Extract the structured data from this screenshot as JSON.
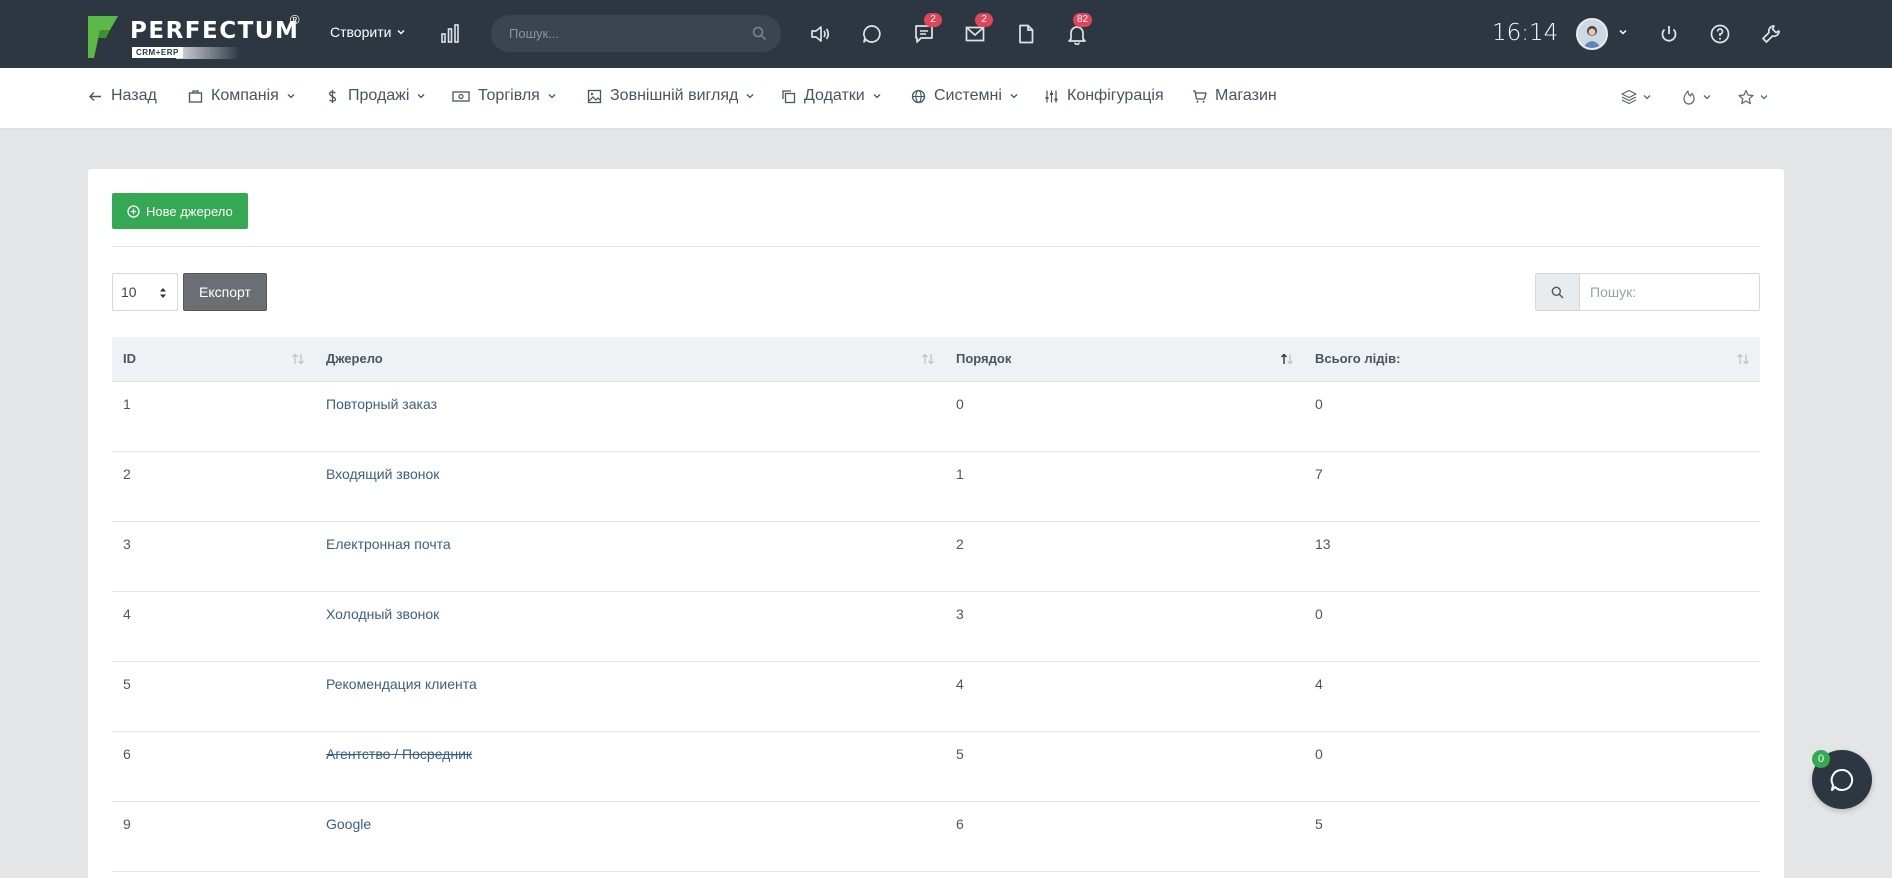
{
  "colors": {
    "topbar": "#2d3742",
    "accent_green": "#34a853",
    "badge_red": "#e0455c",
    "link": "#3a5f86"
  },
  "logo": {
    "word": "PERFECTUM",
    "reg": "®",
    "sub": "CRM+ERP"
  },
  "topbar": {
    "create_label": "Створити",
    "search_placeholder": "Пошук...",
    "badges": {
      "messages": "2",
      "mail": "2",
      "notifications": "82"
    },
    "clock": "16:14"
  },
  "nav": {
    "items": [
      {
        "label": "Назад",
        "icon": "arrow-left-icon"
      },
      {
        "label": "Компанія",
        "icon": "briefcase-icon"
      },
      {
        "label": "Продажі",
        "icon": "dollar-icon"
      },
      {
        "label": "Торгівля",
        "icon": "money-icon"
      },
      {
        "label": "Зовнішній вигляд",
        "icon": "image-icon"
      },
      {
        "label": "Додатки",
        "icon": "copy-icon"
      },
      {
        "label": "Системні",
        "icon": "globe-icon"
      },
      {
        "label": "Конфігурація",
        "icon": "sliders-icon"
      },
      {
        "label": "Магазин",
        "icon": "cart-icon"
      }
    ]
  },
  "toolbar": {
    "new_label": "Нове джерело",
    "page_size": "10",
    "export_label": "Експорт",
    "search_placeholder": "Пошук:"
  },
  "table": {
    "columns": [
      "ID",
      "Джерело",
      "Порядок",
      "Всього лідів:"
    ],
    "sorted_column": "Порядок",
    "rows": [
      {
        "id": "1",
        "source": "Повторный заказ",
        "order": "0",
        "total": "0",
        "struck": false
      },
      {
        "id": "2",
        "source": "Входящий звонок",
        "order": "1",
        "total": "7",
        "struck": false
      },
      {
        "id": "3",
        "source": "Електронная почта",
        "order": "2",
        "total": "13",
        "struck": false
      },
      {
        "id": "4",
        "source": "Холодный звонок",
        "order": "3",
        "total": "0",
        "struck": false
      },
      {
        "id": "5",
        "source": "Рекомендация клиента",
        "order": "4",
        "total": "4",
        "struck": false
      },
      {
        "id": "6",
        "source": "Агентство / Посредник",
        "order": "5",
        "total": "0",
        "struck": true
      },
      {
        "id": "9",
        "source": "Google",
        "order": "6",
        "total": "5",
        "struck": false
      }
    ]
  },
  "chat": {
    "count": "0"
  }
}
